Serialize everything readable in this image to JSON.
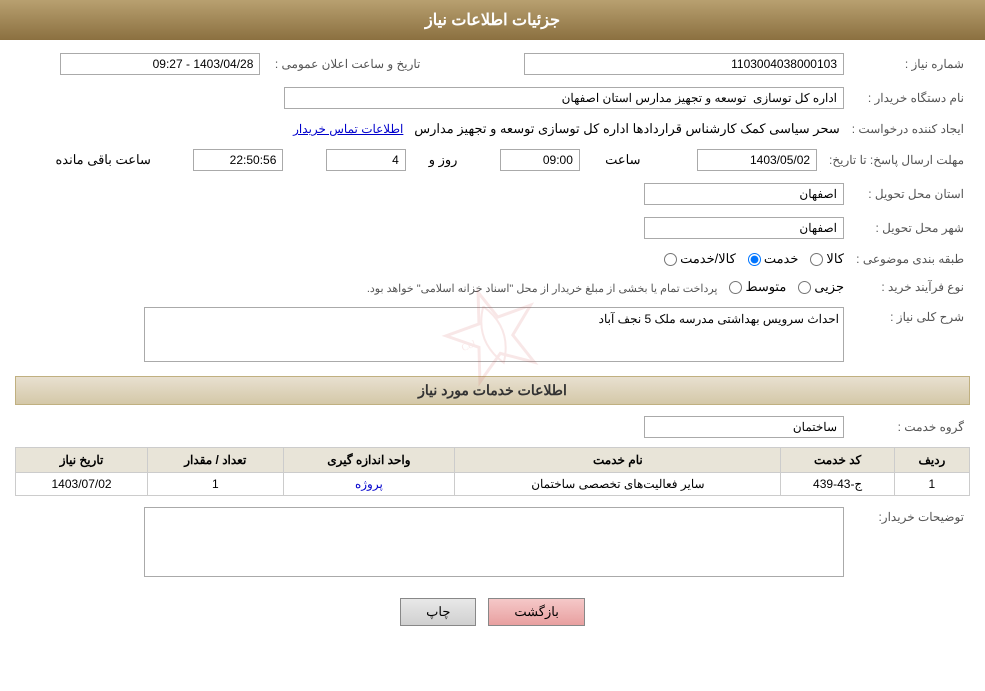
{
  "header": {
    "title": "جزئیات اطلاعات نیاز"
  },
  "fields": {
    "request_number_label": "شماره نیاز :",
    "request_number_value": "1103004038000103",
    "buyer_org_label": "نام دستگاه خریدار :",
    "buyer_org_value": "اداره کل توسازی  توسعه و تجهیز مدارس استان اصفهان",
    "creator_label": "ایجاد کننده درخواست :",
    "creator_value": "سحر سیاسی کمک کارشناس قراردادها اداره کل توسازی  توسعه و تجهیز مدارس",
    "contact_link": "اطلاعات تماس خریدار",
    "announce_date_label": "تاریخ و ساعت اعلان عمومی :",
    "announce_date_value": "1403/04/28 - 09:27",
    "deadline_label": "مهلت ارسال پاسخ: تا تاریخ:",
    "deadline_date": "1403/05/02",
    "deadline_time_label": "ساعت",
    "deadline_time": "09:00",
    "deadline_days_label": "روز و",
    "deadline_days": "4",
    "deadline_remaining_label": "ساعت باقی مانده",
    "deadline_remaining": "22:50:56",
    "province_label": "استان محل تحویل :",
    "province_value": "اصفهان",
    "city_label": "شهر محل تحویل :",
    "city_value": "اصفهان",
    "category_label": "طبقه بندی موضوعی :",
    "category_option1": "کالا",
    "category_option2": "خدمت",
    "category_option3": "کالا/خدمت",
    "category_selected": "خدمت",
    "purchase_type_label": "نوع فرآیند خرید :",
    "purchase_option1": "جزیی",
    "purchase_option2": "متوسط",
    "purchase_note": "پرداخت تمام یا بخشی از مبلغ خریدار از محل \"اسناد خزانه اسلامی\" خواهد بود.",
    "general_desc_label": "شرح کلی نیاز :",
    "general_desc_value": "احداث سرویس بهداشتی مدرسه ملک 5 نجف آباد",
    "services_section_title": "اطلاعات خدمات مورد نیاز",
    "service_group_label": "گروه خدمت :",
    "service_group_value": "ساختمان",
    "table": {
      "headers": [
        "ردیف",
        "کد خدمت",
        "نام خدمت",
        "واحد اندازه گیری",
        "تعداد / مقدار",
        "تاریخ نیاز"
      ],
      "rows": [
        {
          "row": "1",
          "code": "ج-43-439",
          "name": "سایر فعالیت‌های تخصصی ساختمان",
          "unit": "پروژه",
          "quantity": "1",
          "date": "1403/07/02"
        }
      ]
    },
    "buyer_notes_label": "توضیحات خریدار:",
    "buyer_notes_value": ""
  },
  "buttons": {
    "back_label": "بازگشت",
    "print_label": "چاپ"
  }
}
